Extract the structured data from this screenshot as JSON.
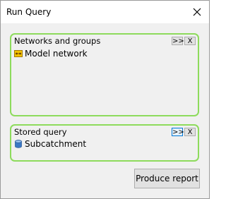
{
  "window": {
    "title": "Run Query",
    "close_glyph": "✕"
  },
  "networks_group": {
    "title": "Networks and groups",
    "expand_label": ">>",
    "remove_label": "X",
    "items": [
      {
        "label": "Model network",
        "icon": "model-network-icon",
        "icon_color": "#e8b800"
      }
    ]
  },
  "query_group": {
    "title": "Stored query",
    "expand_label": ">>",
    "remove_label": "X",
    "items": [
      {
        "label": "Subcatchment",
        "icon": "stored-query-icon",
        "icon_color": "#3b78c4"
      }
    ]
  },
  "actions": {
    "produce_report_label": "Produce report"
  },
  "colors": {
    "group_border": "#8ddb5c",
    "focus_border": "#0078d7"
  }
}
